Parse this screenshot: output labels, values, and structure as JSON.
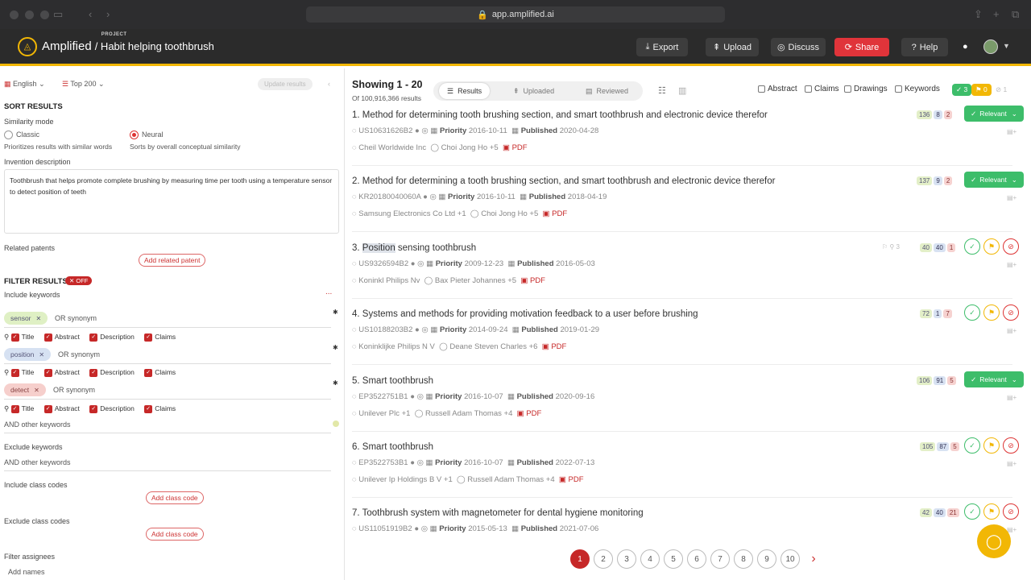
{
  "browser": {
    "url": "app.amplified.ai"
  },
  "app": {
    "brand": "Amplified",
    "project_label": "PROJECT",
    "project_name": "/ Habit helping toothbrush"
  },
  "topnav": {
    "export": "Export",
    "upload": "Upload",
    "discuss": "Discuss",
    "share": "Share",
    "help": "Help"
  },
  "sidebar": {
    "language": "English",
    "top": "Top 200",
    "update": "Update results",
    "sort_results": "SORT RESULTS",
    "similarity_mode": "Similarity mode",
    "classic": "Classic",
    "classic_desc": "Prioritizes results with similar words",
    "neural": "Neural",
    "neural_desc": "Sorts by overall conceptual similarity",
    "invention_description_label": "Invention description",
    "invention_description": "Toothbrush that helps promote complete brushing by measuring time per tooth using a temperature sensor to detect position of teeth",
    "related_patents": "Related patents",
    "add_related_patent": "Add related patent",
    "filter_results": "FILTER RESULTS",
    "filter_toggle": "OFF",
    "include_keywords": "Include keywords",
    "more": "...",
    "keywords": [
      {
        "label": "sensor",
        "or_synonym": "OR synonym",
        "color": "#dff0c4"
      },
      {
        "label": "position",
        "or_synonym": "OR synonym",
        "color": "#d6e1f2"
      },
      {
        "label": "detect",
        "or_synonym": "OR synonym",
        "color": "#f6cfcc"
      }
    ],
    "fields": {
      "title": "Title",
      "abstract": "Abstract",
      "description": "Description",
      "claims": "Claims"
    },
    "and_other_keywords": "AND other keywords",
    "exclude_keywords": "Exclude keywords",
    "and_other_keywords2": "AND other keywords",
    "include_class_codes": "Include class codes",
    "add_class_code": "Add class code",
    "exclude_class_codes": "Exclude class codes",
    "add_class_code2": "Add class code",
    "filter_assignees": "Filter assignees",
    "add_names": "Add names"
  },
  "main": {
    "showing": "Showing 1 - 20",
    "of_results": "Of 100,916,366 results",
    "tabs": {
      "results": "Results",
      "uploaded": "Uploaded",
      "reviewed": "Reviewed"
    },
    "filters": {
      "abstract": "Abstract",
      "claims": "Claims",
      "drawings": "Drawings",
      "keywords": "Keywords"
    },
    "counts": {
      "green": "3",
      "yellow": "0",
      "red": "1"
    },
    "labels": {
      "priority": "Priority",
      "published": "Published",
      "pdf": "PDF",
      "relevant": "Relevant"
    },
    "results": [
      {
        "num": "1.",
        "title": "Method for determining tooth brushing section, and smart toothbrush and electronic device therefor",
        "id": "US10631626B2",
        "priority": "2016-10-11",
        "published": "2020-04-28",
        "assignee": "Cheil Worldwide Inc",
        "inventor": "Choi Jong Ho +5",
        "b1": "136",
        "b2": "8",
        "b3": "2",
        "status": "relevant"
      },
      {
        "num": "2.",
        "title": "Method for determining a tooth brushing section, and smart toothbrush and electronic device therefor",
        "id": "KR20180040060A",
        "priority": "2016-10-11",
        "published": "2018-04-19",
        "assignee": "Samsung Electronics Co Ltd +1",
        "inventor": "Choi Jong Ho +5",
        "b1": "137",
        "b2": "9",
        "b3": "2",
        "status": "relevant"
      },
      {
        "num": "3.",
        "title_hl": "Position",
        "title": " sensing toothbrush",
        "id": "US9326594B2",
        "priority": "2009-12-23",
        "published": "2016-05-03",
        "assignee": "Koninkl Philips Nv",
        "inventor": "Bax Pieter Johannes +5",
        "extra": "3",
        "b1": "40",
        "b2": "40",
        "b3": "1",
        "status": "circles"
      },
      {
        "num": "4.",
        "title": "Systems and methods for providing motivation feedback to a user before brushing",
        "id": "US10188203B2",
        "priority": "2014-09-24",
        "published": "2019-01-29",
        "assignee": "Koninklijke Philips N V",
        "inventor": "Deane Steven Charles +6",
        "b1": "72",
        "b2": "1",
        "b3": "7",
        "status": "circles"
      },
      {
        "num": "5.",
        "title": "Smart toothbrush",
        "id": "EP3522751B1",
        "priority": "2016-10-07",
        "published": "2020-09-16",
        "assignee": "Unilever Plc +1",
        "inventor": "Russell Adam Thomas +4",
        "b1": "106",
        "b2": "91",
        "b3": "5",
        "status": "relevant"
      },
      {
        "num": "6.",
        "title": "Smart toothbrush",
        "id": "EP3522753B1",
        "priority": "2016-10-07",
        "published": "2022-07-13",
        "assignee": "Unilever Ip Holdings B V +1",
        "inventor": "Russell Adam Thomas +4",
        "b1": "105",
        "b2": "87",
        "b3": "5",
        "status": "circles"
      },
      {
        "num": "7.",
        "title": "Toothbrush system with magnetometer for dental hygiene monitoring",
        "id": "US11051919B2",
        "priority": "2015-05-13",
        "published": "2021-07-06",
        "b1": "42",
        "b2": "40",
        "b3": "21",
        "status": "circles"
      }
    ],
    "pages": [
      "1",
      "2",
      "3",
      "4",
      "5",
      "6",
      "7",
      "8",
      "9",
      "10"
    ],
    "next": "›"
  }
}
